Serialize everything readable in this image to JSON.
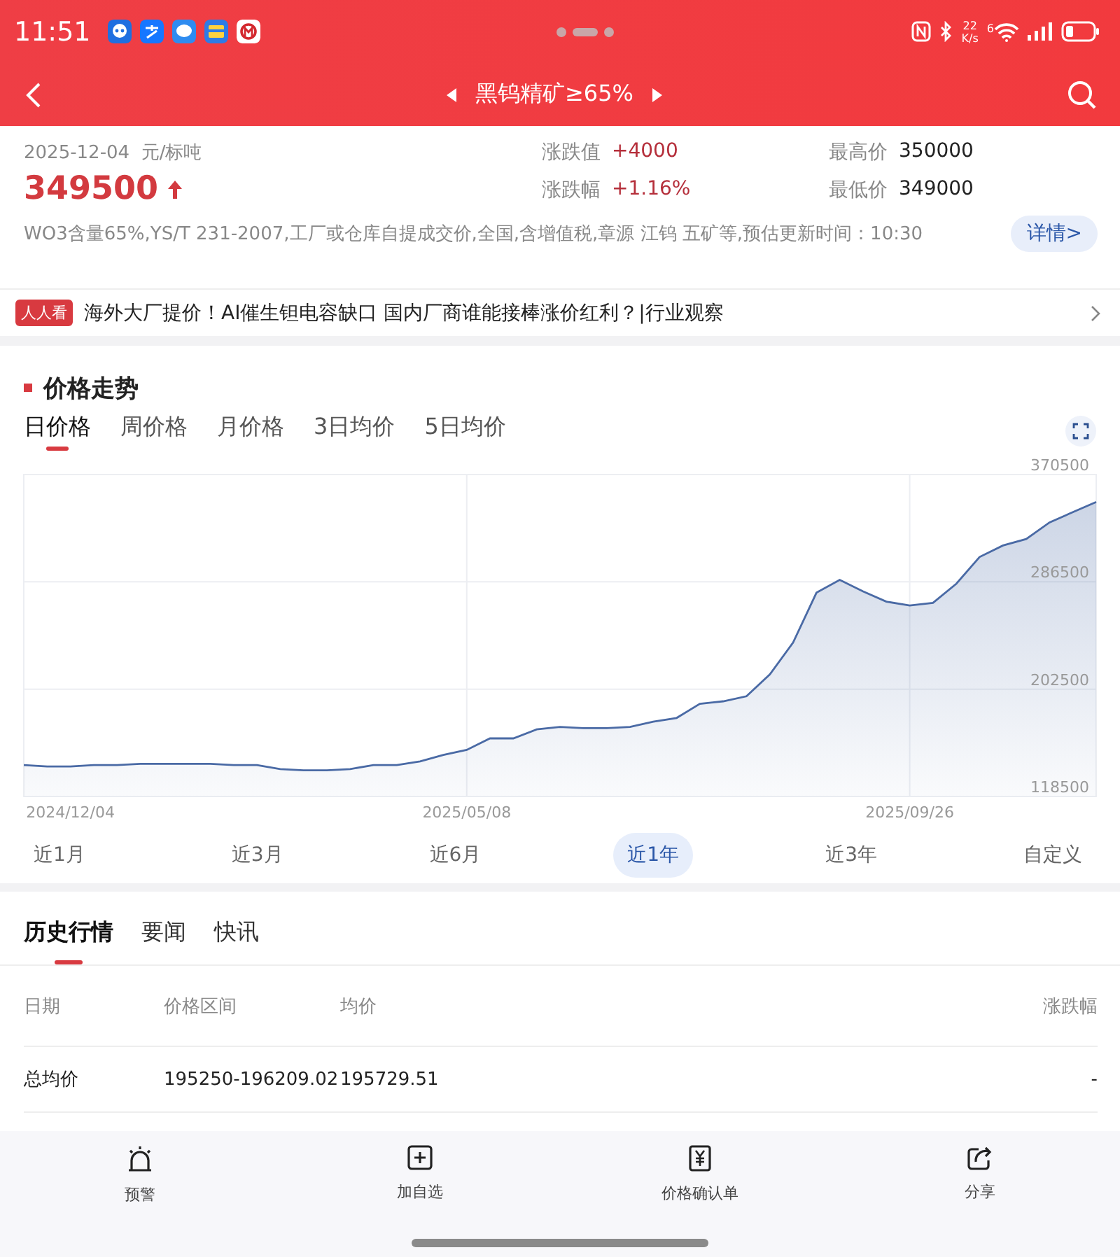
{
  "status_bar": {
    "time": "11:51",
    "speed_value": "22",
    "speed_unit": "K/s",
    "wifi_generation": "6"
  },
  "nav": {
    "title": "黑钨精矿≥65%"
  },
  "quote": {
    "date": "2025-12-04",
    "unit": "元/标吨",
    "price": "349500",
    "stats": [
      {
        "label": "涨跌值",
        "value": "+4000",
        "kind": "change"
      },
      {
        "label": "最高价",
        "value": "350000",
        "kind": "plain"
      },
      {
        "label": "涨跌幅",
        "value": "+1.16%",
        "kind": "change"
      },
      {
        "label": "最低价",
        "value": "349000",
        "kind": "plain"
      }
    ],
    "description": "WO3含量65%,YS/T 231-2007,工厂或仓库自提成交价,全国,含增值税,章源 江钨 五矿等,预估更新时间：10:30",
    "details_button": "详情>"
  },
  "news": {
    "tag": "人人看",
    "headline": "海外大厂提价！AI催生钽电容缺口 国内厂商谁能接棒涨价红利？|行业观察"
  },
  "trend": {
    "title": "价格走势",
    "tabs": [
      {
        "label": "日价格",
        "selected": true
      },
      {
        "label": "周价格",
        "selected": false
      },
      {
        "label": "月价格",
        "selected": false
      },
      {
        "label": "3日均价",
        "selected": false
      },
      {
        "label": "5日均价",
        "selected": false
      }
    ],
    "chart_data": {
      "type": "area",
      "categories": [
        null,
        null,
        "2024/12/04",
        null,
        null,
        null,
        null,
        null,
        null,
        null,
        null,
        null,
        null,
        null,
        null,
        null,
        null,
        null,
        null,
        "2025/05/08",
        null,
        null,
        null,
        null,
        null,
        null,
        null,
        null,
        null,
        null,
        null,
        null,
        null,
        null,
        null,
        null,
        null,
        null,
        "2025/09/26",
        null,
        null,
        null,
        null,
        null,
        null,
        null,
        null
      ],
      "series": [
        {
          "color": "#4a6aa5",
          "values": [
            143000,
            142000,
            142000,
            143000,
            143000,
            144000,
            144000,
            144000,
            144000,
            143000,
            143000,
            140000,
            139000,
            139000,
            140000,
            143000,
            143000,
            146000,
            151000,
            155000,
            164000,
            164000,
            171000,
            173000,
            172000,
            172000,
            173000,
            177000,
            180000,
            191000,
            193000,
            197000,
            214000,
            239000,
            278000,
            288000,
            279000,
            271000,
            268000,
            270000,
            285000,
            306000,
            315000,
            320000,
            333000,
            341000,
            349000
          ]
        }
      ],
      "grid": true,
      "ylim": [
        118500,
        370500
      ],
      "yticks": [
        118500,
        202500,
        286500,
        370500
      ]
    },
    "ranges": [
      {
        "label": "近1月",
        "selected": false
      },
      {
        "label": "近3月",
        "selected": false
      },
      {
        "label": "近6月",
        "selected": false
      },
      {
        "label": "近1年",
        "selected": true
      },
      {
        "label": "近3年",
        "selected": false
      },
      {
        "label": "自定义",
        "selected": false
      }
    ]
  },
  "history": {
    "tabs": [
      {
        "label": "历史行情",
        "selected": true
      },
      {
        "label": "要闻",
        "selected": false
      },
      {
        "label": "快讯",
        "selected": false
      }
    ],
    "columns": [
      "日期",
      "价格区间",
      "均价",
      "涨跌幅"
    ],
    "rows": [
      [
        "总均价",
        "195250-196209.02",
        "195729.51",
        "-"
      ]
    ]
  },
  "bottom_bar": [
    {
      "label": "预警",
      "kind": "alarm"
    },
    {
      "label": "加自选",
      "kind": "add"
    },
    {
      "label": "价格确认单",
      "kind": "receipt"
    },
    {
      "label": "分享",
      "kind": "share"
    }
  ]
}
